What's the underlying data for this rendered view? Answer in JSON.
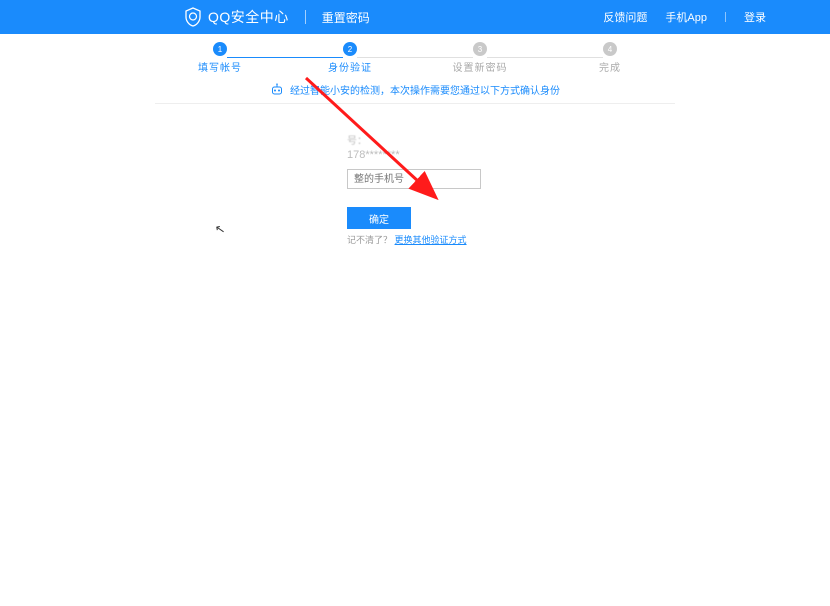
{
  "header": {
    "brand": "QQ安全中心",
    "subtitle": "重置密码",
    "links": {
      "feedback": "反馈问题",
      "app": "手机App",
      "login": "登录"
    }
  },
  "steps": [
    {
      "num": "1",
      "label": "填写帐号",
      "active": true
    },
    {
      "num": "2",
      "label": "身份验证",
      "active": true
    },
    {
      "num": "3",
      "label": "设置新密码",
      "active": false
    },
    {
      "num": "4",
      "label": "完成",
      "active": false
    }
  ],
  "notice": "经过智能小安的检测，本次操作需要您通过以下方式确认身份",
  "form": {
    "masked_label": "号：",
    "masked_phone": "178********",
    "placeholder": "整的手机号",
    "confirm": "确定",
    "cant_remember": "记不清了？",
    "alt_link": "更换其他验证方式"
  },
  "colors": {
    "primary": "#1a8bfc",
    "arrow": "#ff1b1b"
  }
}
